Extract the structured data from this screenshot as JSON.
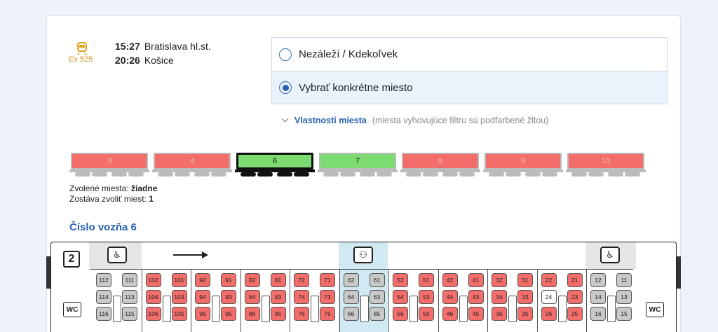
{
  "train": {
    "icon": "train-icon",
    "number": "Ex 525",
    "dep_time": "15:27",
    "dep_station": "Bratislava hl.st.",
    "arr_time": "20:26",
    "arr_station": "Košice"
  },
  "options": [
    {
      "label": "Nezáleží / Kdekoľvek",
      "selected": false
    },
    {
      "label": "Vybrať konkrétne miesto",
      "selected": true
    }
  ],
  "properties": {
    "link": "Vlastnosti miesta",
    "note": "(miesta vyhovujúce filtru sú podfarbené žltou)"
  },
  "wagons": [
    {
      "num": "3",
      "state": "red"
    },
    {
      "num": "4",
      "state": "red"
    },
    {
      "num": "6",
      "state": "green",
      "selected": true
    },
    {
      "num": "7",
      "state": "green"
    },
    {
      "num": "8",
      "state": "red"
    },
    {
      "num": "9",
      "state": "red"
    },
    {
      "num": "10",
      "state": "red"
    }
  ],
  "selection": {
    "chosen_label": "Zvolené miesta:",
    "chosen_value": "žiadne",
    "remaining_label": "Zostáva zvoliť miest:",
    "remaining_value": "1"
  },
  "coach_title": "Číslo vozňa 6",
  "coach": {
    "class": "2",
    "wc": "WC",
    "icons": [
      "wheelchair-icon",
      "accessible-icon",
      "wheelchair-icon"
    ],
    "rows_top": [
      [
        "112",
        "111",
        "102",
        "101",
        "92",
        "91",
        "82",
        "81",
        "72",
        "71",
        "62",
        "61",
        "52",
        "51",
        "42",
        "41",
        "32",
        "31",
        "22",
        "21",
        "12",
        "11"
      ]
    ],
    "rows_mid": [
      [
        "114",
        "113",
        "104",
        "103",
        "94",
        "93",
        "84",
        "83",
        "74",
        "73",
        "64",
        "63",
        "54",
        "53",
        "44",
        "43",
        "34",
        "33",
        "24",
        "23",
        "14",
        "13"
      ]
    ],
    "rows_bot": [
      [
        "116",
        "115",
        "106",
        "105",
        "96",
        "95",
        "86",
        "85",
        "76",
        "75",
        "66",
        "65",
        "56",
        "55",
        "46",
        "45",
        "36",
        "35",
        "26",
        "25",
        "16",
        "15"
      ]
    ],
    "gray_seats": [
      "112",
      "111",
      "114",
      "113",
      "116",
      "115",
      "62",
      "61",
      "64",
      "63",
      "66",
      "65",
      "12",
      "11",
      "14",
      "13",
      "16",
      "15"
    ],
    "white_seats": [
      "24"
    ]
  }
}
